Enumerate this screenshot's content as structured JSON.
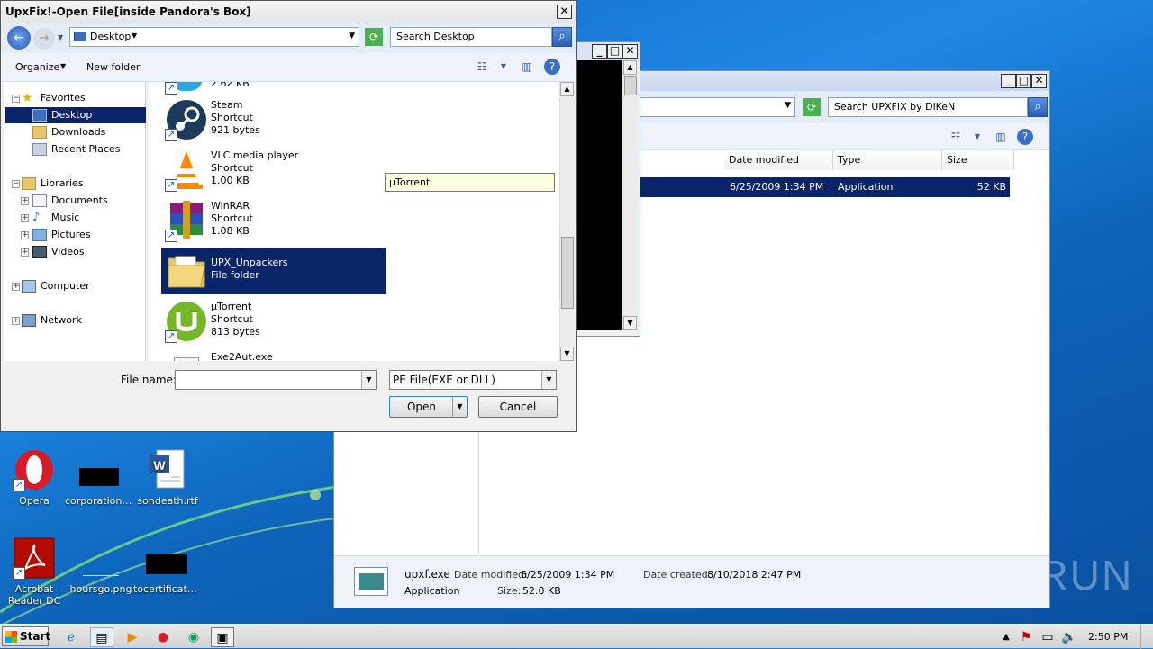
{
  "desktop": {
    "icons": [
      {
        "label": "Opera"
      },
      {
        "label": "corporationf..."
      },
      {
        "label": "sondeath.rtf"
      },
      {
        "label": "Acrobat Reader DC"
      },
      {
        "label": "hoursgo.png"
      },
      {
        "label": "tocertificate..."
      }
    ],
    "watermark": "ANY RUN"
  },
  "explorer": {
    "search_placeholder": "Search UPXFIX by DiKeN",
    "columns": [
      "Date modified",
      "Type",
      "Size"
    ],
    "row": {
      "date": "6/25/2009 1:34 PM",
      "type": "Application",
      "size": "52 KB"
    },
    "details": {
      "filename": "upxf.exe",
      "date_modified_label": "Date modified:",
      "date_modified": "6/25/2009 1:34 PM",
      "date_created_label": "Date created:",
      "date_created": "8/10/2018 2:47 PM",
      "type": "Application",
      "size_label": "Size:",
      "size": "52.0 KB"
    }
  },
  "dialog": {
    "title": "UpxFix!-Open File[inside Pandora's Box]",
    "location": "Desktop",
    "search_placeholder": "Search Desktop",
    "toolbar": {
      "organize": "Organize",
      "new_folder": "New folder"
    },
    "nav": {
      "favorites": "Favorites",
      "desktop": "Desktop",
      "downloads": "Downloads",
      "recent": "Recent Places",
      "libraries": "Libraries",
      "documents": "Documents",
      "music": "Music",
      "pictures": "Pictures",
      "videos": "Videos",
      "computer": "Computer",
      "network": "Network"
    },
    "files": [
      {
        "name": "",
        "type": "",
        "size": "2.62 KB"
      },
      {
        "name": "Steam",
        "type": "Shortcut",
        "size": "921 bytes"
      },
      {
        "name": "VLC media player",
        "type": "Shortcut",
        "size": "1.00 KB"
      },
      {
        "name": "WinRAR",
        "type": "Shortcut",
        "size": "1.08 KB"
      },
      {
        "name": "UPX_Unpackers",
        "type": "File folder",
        "size": ""
      },
      {
        "name": "µTorrent",
        "type": "Shortcut",
        "size": "813 bytes"
      },
      {
        "name": "Exe2Aut.exe",
        "type": "",
        "size": ""
      }
    ],
    "tooltip": "µTorrent",
    "filename_label": "File name:",
    "filename_value": "",
    "filter": "PE File(EXE or DLL)",
    "open": "Open",
    "cancel": "Cancel"
  },
  "taskbar": {
    "start": "Start",
    "time": "2:50 PM"
  },
  "colors": {
    "selection": "#0a246a",
    "desktop_blue": "#1e88e5"
  }
}
